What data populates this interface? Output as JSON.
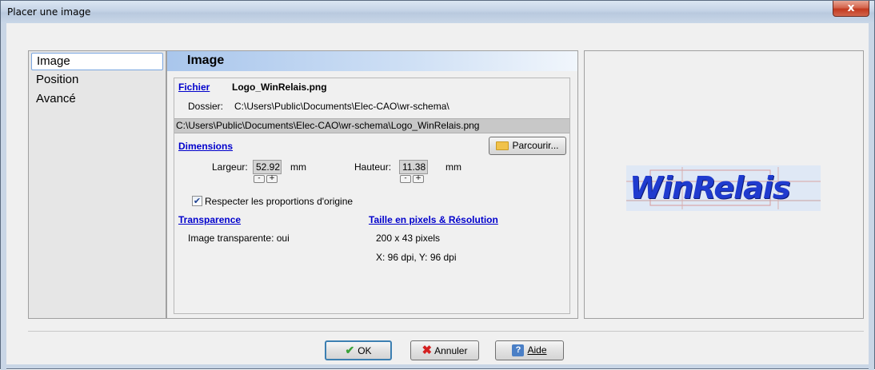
{
  "window": {
    "title": "Placer une image",
    "close_label": "x"
  },
  "nav": {
    "items": [
      {
        "label": "Image",
        "selected": true
      },
      {
        "label": "Position",
        "selected": false
      },
      {
        "label": "Avancé",
        "selected": false
      }
    ]
  },
  "panel": {
    "header": "Image",
    "fichier_label": "Fichier",
    "file_name": "Logo_WinRelais.png",
    "dossier_label": "Dossier:",
    "dossier_value": "C:\\Users\\Public\\Documents\\Elec-CAO\\wr-schema\\",
    "full_path": "C:\\Users\\Public\\Documents\\Elec-CAO\\wr-schema\\Logo_WinRelais.png",
    "browse_label": "Parcourir...",
    "dimensions_label": "Dimensions",
    "largeur_label": "Largeur:",
    "largeur_value": "52.92",
    "largeur_unit": "mm",
    "hauteur_label": "Hauteur:",
    "hauteur_value": "11.38",
    "hauteur_unit": "mm",
    "spin_minus": "-",
    "spin_plus": "+",
    "keep_ratio_label": "Respecter les proportions d'origine",
    "keep_ratio_checked": true,
    "transparence_label": "Transparence",
    "transparent_text": "Image transparente:  oui",
    "taille_label": "Taille en pixels & Résolution",
    "pixels_text": "200 x 43 pixels",
    "dpi_text": "X: 96 dpi, Y: 96 dpi"
  },
  "preview": {
    "logo_text": "WinRelais"
  },
  "footer": {
    "ok_label": "OK",
    "cancel_label": "Annuler",
    "help_label": "Aide"
  },
  "colors": {
    "link": "#0000cc",
    "logo_blue": "#1f3bcf",
    "header_blue": "#a9c6ec"
  }
}
